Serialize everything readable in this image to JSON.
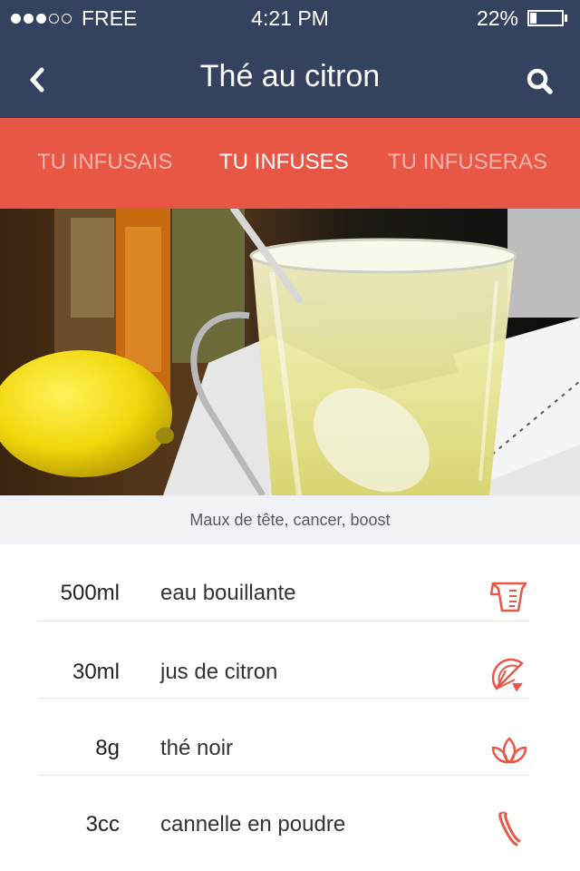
{
  "status": {
    "signal_full": 3,
    "signal_empty": 2,
    "carrier": "FREE",
    "time": "4:21  PM",
    "battery_percent": "22%",
    "battery_level": 0.22
  },
  "nav": {
    "back_icon": "chevron-left-icon",
    "title": "Thé au citron",
    "search_icon": "search-icon"
  },
  "tabs": [
    {
      "label": "TU INFUSAIS",
      "active": false
    },
    {
      "label": "TU INFUSES",
      "active": true
    },
    {
      "label": "TU INFUSERAS",
      "active": false
    }
  ],
  "hero": {
    "caption": "Maux de tête, cancer, boost"
  },
  "ingredients": [
    {
      "qty": "500ml",
      "name": "eau bouillante",
      "icon": "measuring-cup-icon"
    },
    {
      "qty": "30ml",
      "name": "jus de citron",
      "icon": "lemon-slice-icon"
    },
    {
      "qty": "8g",
      "name": "thé noir",
      "icon": "tea-leaf-icon"
    },
    {
      "qty": "3cc",
      "name": "cannelle en poudre",
      "icon": "cinnamon-stick-icon"
    }
  ],
  "colors": {
    "header_bg": "#34425f",
    "tab_bar_bg": "#e85745",
    "tab_inactive": "#f7b5ab",
    "tab_active": "#ffffff",
    "icon_accent": "#e85745",
    "caption_bg": "#f1f2f6"
  }
}
